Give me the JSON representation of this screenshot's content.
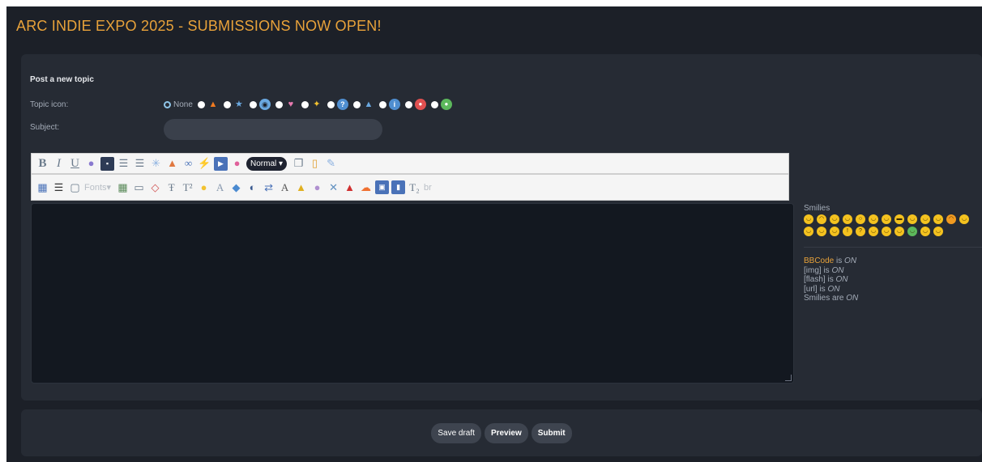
{
  "topic_title": "ARC INDIE EXPO 2025 - SUBMISSIONS NOW OPEN!",
  "form": {
    "heading": "Post a new topic",
    "topic_icon_label": "Topic icon:",
    "icon_none_label": "None",
    "topic_icons": [
      "flame-icon",
      "star-icon",
      "shocked-face-icon",
      "heart-icon",
      "sparkle-icon",
      "question-icon",
      "warning-icon",
      "info-icon",
      "angry-face-icon",
      "alien-face-icon"
    ],
    "subject_label": "Subject:",
    "subject_value": ""
  },
  "toolbar": {
    "size_select": "Normal",
    "fonts_label": "Fonts",
    "subscript_label": "T₂",
    "br_label": "br"
  },
  "editor": {
    "value": ""
  },
  "sidebar": {
    "smilies_title": "Smilies",
    "smilies_count": 24,
    "bbcode_link": "BBCode",
    "is_label": "is",
    "are_label": "are",
    "on_label": "ON",
    "img_label": "[img]",
    "flash_label": "[flash]",
    "url_label": "[url]",
    "smilies_label": "Smilies"
  },
  "buttons": {
    "save_draft": "Save draft",
    "preview": "Preview",
    "submit": "Submit"
  },
  "colors": {
    "accent": "#e8a23a",
    "page_bg": "#1c2028",
    "panel_bg": "#262b34",
    "editor_bg": "#131820"
  }
}
